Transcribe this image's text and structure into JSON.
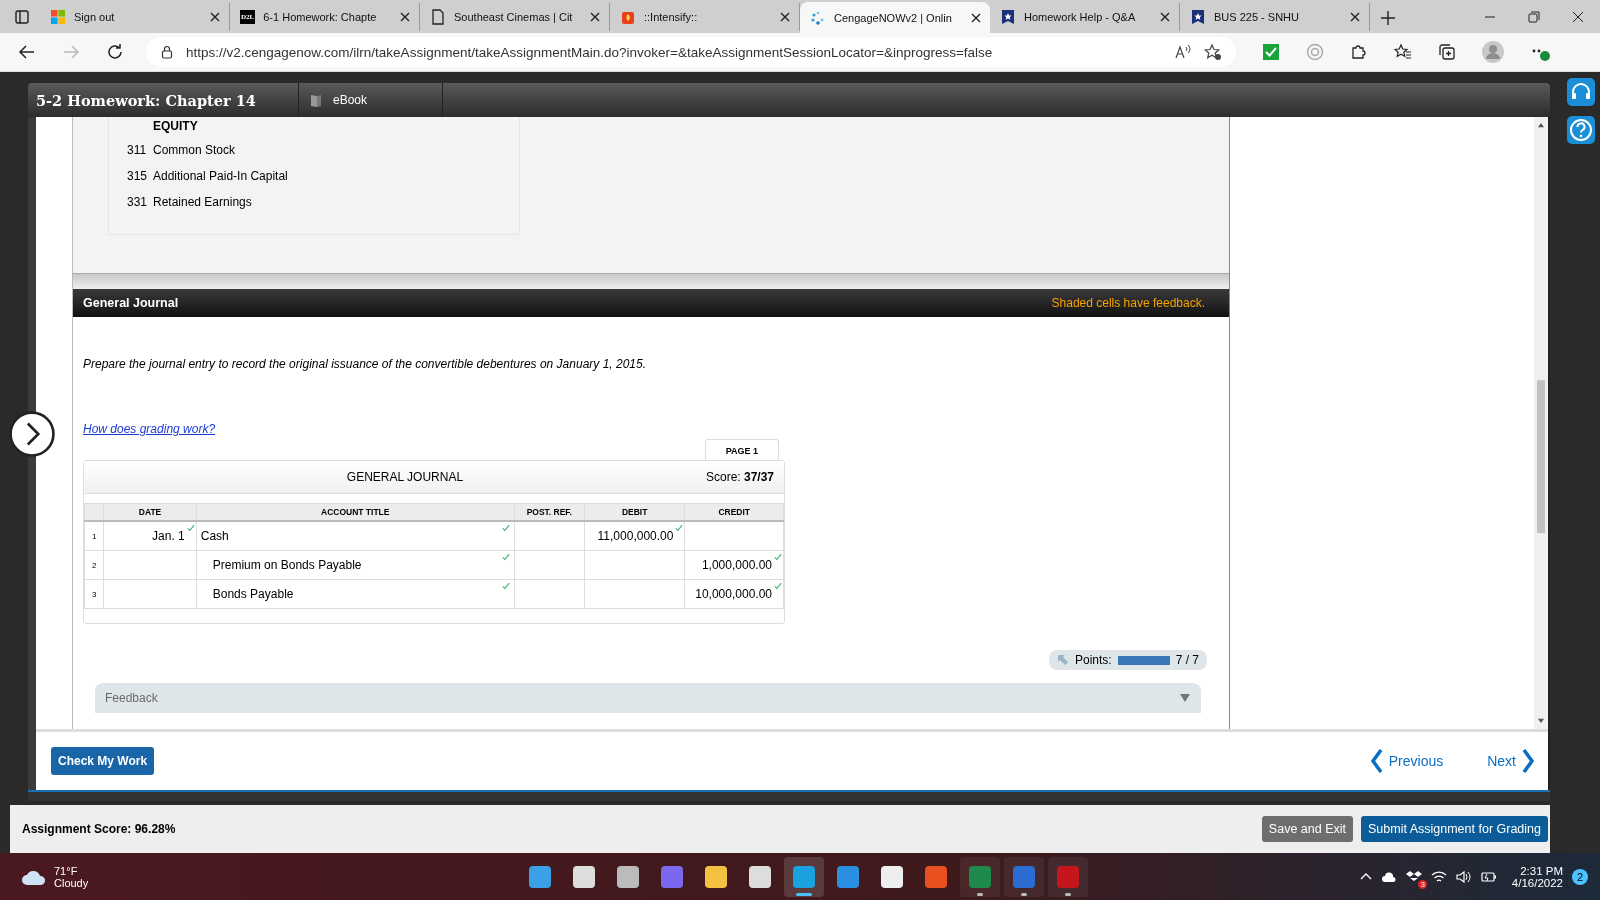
{
  "browser": {
    "tabs": [
      {
        "title": "Sign out",
        "kind": "squares",
        "selected": false
      },
      {
        "title": "6-1 Homework: Chapte",
        "kind": "logo",
        "logo_text": "D2L",
        "selected": false
      },
      {
        "title": "Southeast Cinemas | Cit",
        "kind": "page",
        "selected": false
      },
      {
        "title": "::Intensify::",
        "kind": "flame",
        "selected": false
      },
      {
        "title": "CengageNOWv2 | Onlin",
        "kind": "dots",
        "selected": true
      },
      {
        "title": "Homework Help - Q&A",
        "kind": "shield",
        "selected": false
      },
      {
        "title": "BUS 225 - SNHU",
        "kind": "shield",
        "selected": false
      }
    ],
    "address": "https://v2.cengagenow.com/ilrn/takeAssignment/takeAssignmentMain.do?invoker=&takeAssignmentSessionLocator=&inprogress=false"
  },
  "assignment": {
    "title": "5-2 Homework: Chapter 14",
    "tab": "eBook"
  },
  "chart_of_accounts": {
    "heading": "EQUITY",
    "accounts": [
      {
        "number": "311",
        "name": "Common Stock"
      },
      {
        "number": "315",
        "name": "Additional Paid-In Capital"
      },
      {
        "number": "331",
        "name": "Retained Earnings"
      }
    ]
  },
  "general_journal": {
    "title": "General Journal",
    "note": "Shaded cells have feedback.",
    "instruction": "Prepare the journal entry to record the original issuance of the convertible debentures on January 1, 2015.",
    "help_link": "How does grading work?",
    "page_tab": "PAGE 1",
    "table_title": "GENERAL JOURNAL",
    "score_label": "Score:",
    "score": "37/37",
    "columns": [
      "DATE",
      "ACCOUNT TITLE",
      "POST. REF.",
      "DEBIT",
      "CREDIT"
    ],
    "rows": [
      {
        "number": "1",
        "date": {
          "text": "Jan. 1",
          "correct": true
        },
        "account": {
          "text": "Cash",
          "correct": true,
          "indented": false
        },
        "debit": {
          "text": "11,000,000.00",
          "correct": true
        }
      },
      {
        "number": "2",
        "account": {
          "text": "Premium on Bonds Payable",
          "correct": true,
          "indented": true
        },
        "credit": {
          "text": "1,000,000.00",
          "correct": true
        }
      },
      {
        "number": "3",
        "account": {
          "text": "Bonds Payable",
          "correct": true,
          "indented": true
        },
        "credit": {
          "text": "10,000,000.00",
          "correct": true
        }
      }
    ]
  },
  "points": {
    "label": "Points:",
    "level": 1,
    "reading": "7 / 7"
  },
  "feedback": {
    "label": "Feedback",
    "expanded": false
  },
  "navigation": {
    "check": "Check My Work",
    "previous": "Previous",
    "next": "Next"
  },
  "footer": {
    "score": "Assignment Score: 96.28%",
    "save": "Save and Exit",
    "submit": "Submit Assignment for Grading"
  },
  "taskbar": {
    "temperature": "71°F",
    "condition": "Cloudy",
    "apps": [
      {
        "kind": "start",
        "active": false,
        "running": false
      },
      {
        "kind": "search",
        "active": false,
        "running": false
      },
      {
        "kind": "views",
        "active": false,
        "running": false
      },
      {
        "kind": "chat",
        "active": false,
        "running": false
      },
      {
        "kind": "folder",
        "active": false,
        "running": false
      },
      {
        "kind": "store",
        "active": false,
        "running": false
      },
      {
        "kind": "browser",
        "active": true,
        "running": true
      },
      {
        "kind": "mail",
        "active": false,
        "running": false
      },
      {
        "kind": "circle",
        "active": false,
        "running": false
      },
      {
        "kind": "office",
        "active": false,
        "running": false
      },
      {
        "kind": "sheet",
        "active": false,
        "running": true
      },
      {
        "kind": "doc",
        "active": false,
        "running": true
      },
      {
        "kind": "pdf",
        "active": false,
        "running": true
      }
    ],
    "tray_badge": "3",
    "time": "2:31 PM",
    "date": "4/16/2022",
    "notifications": "2"
  }
}
